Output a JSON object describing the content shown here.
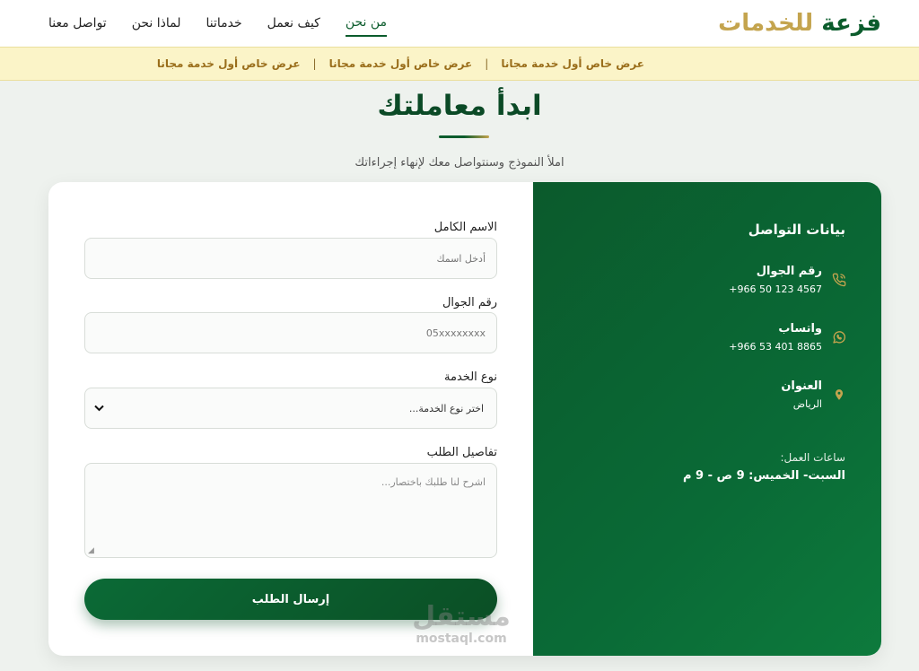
{
  "header": {
    "logo": {
      "part1": "فزعة",
      "part2": "للخدمات"
    },
    "nav": [
      {
        "label": "من نحن",
        "active": true
      },
      {
        "label": "كيف نعمل",
        "active": false
      },
      {
        "label": "خدماتنا",
        "active": false
      },
      {
        "label": "لماذا نحن",
        "active": false
      },
      {
        "label": "تواصل معنا",
        "active": false
      }
    ]
  },
  "promo": {
    "items": [
      "عرض خاص أول خدمة مجانا",
      "عرض خاص أول خدمة مجانا",
      "عرض خاص أول خدمة مجانا"
    ],
    "separator": "|"
  },
  "main": {
    "title": "ابدأ معاملتك",
    "subtitle": "املأ النموذج وسنتواصل معك لإنهاء إجراءاتك"
  },
  "form": {
    "name": {
      "label": "الاسم الكامل",
      "placeholder": "أدخل اسمك"
    },
    "phone": {
      "label": "رقم الجوال",
      "placeholder": "05xxxxxxxx"
    },
    "service": {
      "label": "نوع الخدمة",
      "selected": "اختر نوع الخدمة..."
    },
    "details": {
      "label": "تفاصيل الطلب",
      "placeholder": "اشرح لنا طلبك باختصار..."
    },
    "submit_label": "إرسال الطلب"
  },
  "contact": {
    "title": "بيانات التواصل",
    "phone": {
      "label": "رقم الجوال",
      "value": "+966 50 123 4567",
      "icon": "phone-icon"
    },
    "whatsapp": {
      "label": "واتساب",
      "value": "+966 53 401 8865",
      "icon": "whatsapp-icon"
    },
    "address": {
      "label": "العنوان",
      "value": "الرياض",
      "icon": "location-icon"
    },
    "hours_label": "ساعات العمل:",
    "hours_value": "السبت- الخميس: 9 ص - 9 م"
  },
  "watermark": {
    "arabic": "مستقل",
    "latin": "mostaql.com"
  },
  "colors": {
    "primary": "#0b5c2c",
    "gold": "#c4a44e",
    "promo_bg": "#fbf4c8"
  }
}
